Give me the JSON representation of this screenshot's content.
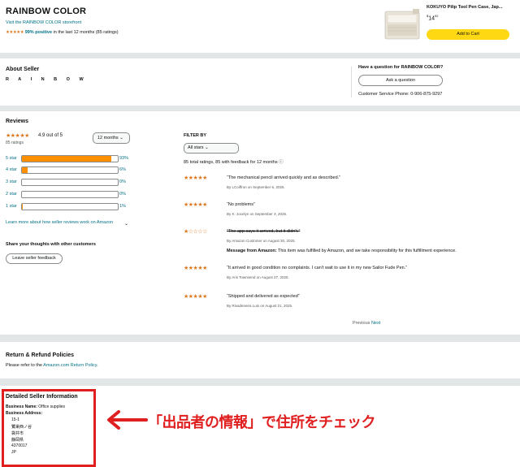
{
  "header": {
    "store_name": "RAINBOW COLOR",
    "storefront_link": "Visit the RAINBOW COLOR storefront",
    "stars": "★★★★★",
    "positive": "99% positive",
    "positive_suffix": " in the last 12 months (85 ratings)",
    "product_name": "KOKUYO Pilip Tool Pen Case, Jap...",
    "price_symbol": "$",
    "price_whole": "14",
    "price_fraction": "92",
    "add_to_cart": "Add to Cart"
  },
  "about": {
    "title": "About Seller",
    "logo_text": "R A I N B O W",
    "question_title": "Have a question for RAINBOW COLOR?",
    "ask_button": "Ask a question",
    "phone": "Customer Service Phone: 0-906-875-9297"
  },
  "reviews": {
    "title": "Reviews",
    "stars": "★★★★★",
    "out_of": "4.9 out of 5",
    "ratings_count": "85 ratings",
    "period": "12 months",
    "histogram": [
      {
        "label": "5 star",
        "percent": 93,
        "pct_text": "93%"
      },
      {
        "label": "4 star",
        "percent": 6,
        "pct_text": "6%"
      },
      {
        "label": "3 star",
        "percent": 0,
        "pct_text": "0%"
      },
      {
        "label": "2 star",
        "percent": 0,
        "pct_text": "0%"
      },
      {
        "label": "1 star",
        "percent": 1,
        "pct_text": "1%"
      }
    ],
    "learn_more": "Learn more about how seller reviews work on Amazon",
    "share_title": "Share your thoughts with other customers",
    "leave_feedback": "Leave seller feedback",
    "filter_title": "FILTER BY",
    "filter_value": "All stars",
    "total_text": "85 total ratings, 85 with feedback for 12 months",
    "items": [
      {
        "stars": "★★★★★",
        "text": "“The mechanical pencil arrived quickly and as described.”",
        "by": "By LCoiffron on September 6, 2025."
      },
      {
        "stars": "★★★★★",
        "text": "“No problems”",
        "by": "By K. Jocelyn on September 3, 2025."
      },
      {
        "stars": "★☆☆☆☆",
        "text": "“The app says it arrived, but it didn't.”",
        "by": "By Amazon Customer on August 30, 2025.",
        "message_label": "Message from Amazon:",
        "message": " This item was fulfilled by Amazon, and we take responsibility for this fulfillment experience."
      },
      {
        "stars": "★★★★★",
        "text": "“It arrived in good condition no complaints. I can't wait to use it in my new Sailor Fude Pen.”",
        "by": "By Aris Townsend on August 27, 2025."
      },
      {
        "stars": "★★★★★",
        "text": "“Shipped and delivered as expected”",
        "by": "By Rivadeneira Luis on August 21, 2025."
      }
    ],
    "previous": "Previous",
    "next": "Next"
  },
  "returns": {
    "title": "Return & Refund Policies",
    "text_prefix": "Please refer to the ",
    "link": "Amazon.com Return Policy",
    "text_suffix": "."
  },
  "detail": {
    "title": "Detailed Seller Information",
    "business_name_label": "Business Name:",
    "business_name": " Office supplies",
    "business_address_label": "Business Address:",
    "address_lines": [
      "15-1",
      "鷺巣西ノ谷",
      "袋井市",
      "静岡県",
      "4370017",
      "JP"
    ]
  },
  "annotation": {
    "text": "「出品者の情報」で住所をチェック",
    "color": "#e02020"
  }
}
